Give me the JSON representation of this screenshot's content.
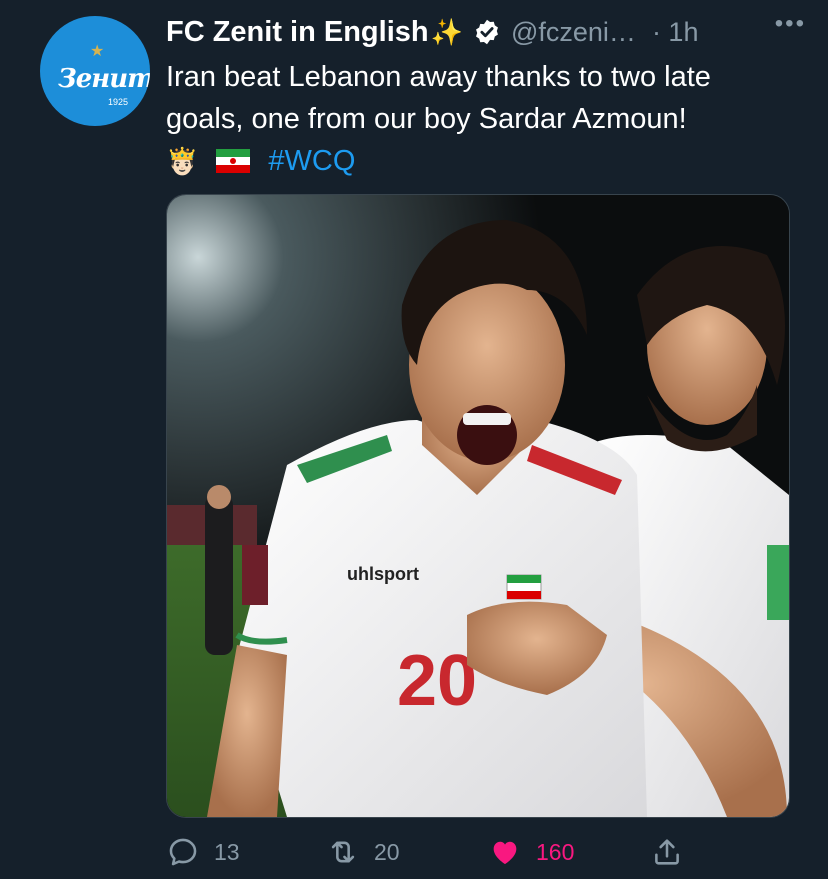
{
  "author": {
    "display_name": "FC Zenit in English",
    "sparkles": "✨",
    "handle": "@fczeni…",
    "time": "· 1h",
    "avatar": {
      "wordmark": "Зенит",
      "year": "1925"
    }
  },
  "more_label": "•••",
  "tweet": {
    "text_line1": "Iran beat Lebanon away thanks to two late",
    "text_line2": "goals, one from our boy Sardar Azmoun!",
    "emoji_crown": "🤴🏻",
    "hashtag": "#WCQ"
  },
  "media": {
    "jersey_brand": "uhlsport",
    "jersey_number": "20"
  },
  "actions": {
    "replies": "13",
    "retweets": "20",
    "likes": "160"
  },
  "colors": {
    "background": "#15202b",
    "secondary_text": "#8899a6",
    "link": "#1d9bf0",
    "like": "#f91880"
  }
}
